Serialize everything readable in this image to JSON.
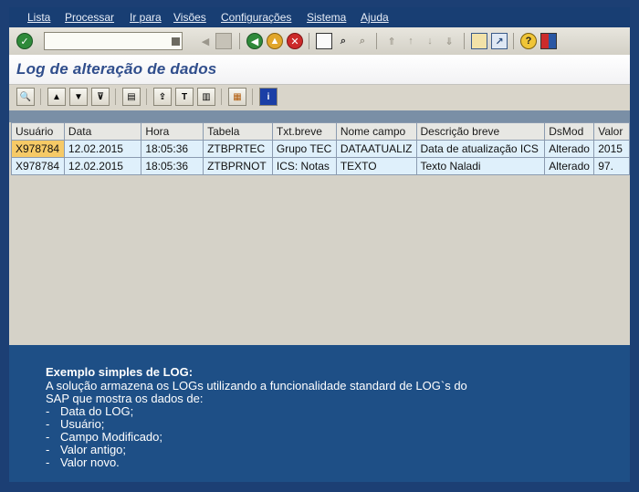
{
  "menu": [
    "Lista",
    "Processar",
    "Ir para",
    "Visões",
    "Configurações",
    "Sistema",
    "Ajuda"
  ],
  "title": "Log de alteração de dados",
  "command_field": {
    "value": ""
  },
  "table": {
    "columns": [
      "Usuário",
      "Data",
      "Hora",
      "Tabela",
      "Txt.breve",
      "Nome campo",
      "Descrição breve",
      "DsMod",
      "Valor"
    ],
    "rows": [
      [
        "X978784",
        "12.02.2015",
        "18:05:36",
        "ZTBPRTEC",
        "Grupo TEC",
        "DATAATUALIZ",
        "Data de atualização ICS",
        "Alterado",
        "2015"
      ],
      [
        "X978784",
        "12.02.2015",
        "18:05:36",
        "ZTBPRNOT",
        "ICS: Notas",
        "TEXTO",
        "Texto Naladi",
        "Alterado",
        "97."
      ]
    ]
  },
  "info": {
    "heading": "Exemplo simples de LOG:",
    "line1": "A solução armazena os LOGs utilizando a funcionalidade standard de LOG`s do",
    "line2": "SAP que mostra os dados de:",
    "bullets": [
      "Data do LOG;",
      "Usuário;",
      "Campo Modificado;",
      "Valor antigo;",
      "Valor novo."
    ]
  },
  "colors": {
    "menubar": "#183e73",
    "selected_cell": "#f6ca66",
    "row": "#dff0fb",
    "info_panel": "#1e4f86"
  }
}
